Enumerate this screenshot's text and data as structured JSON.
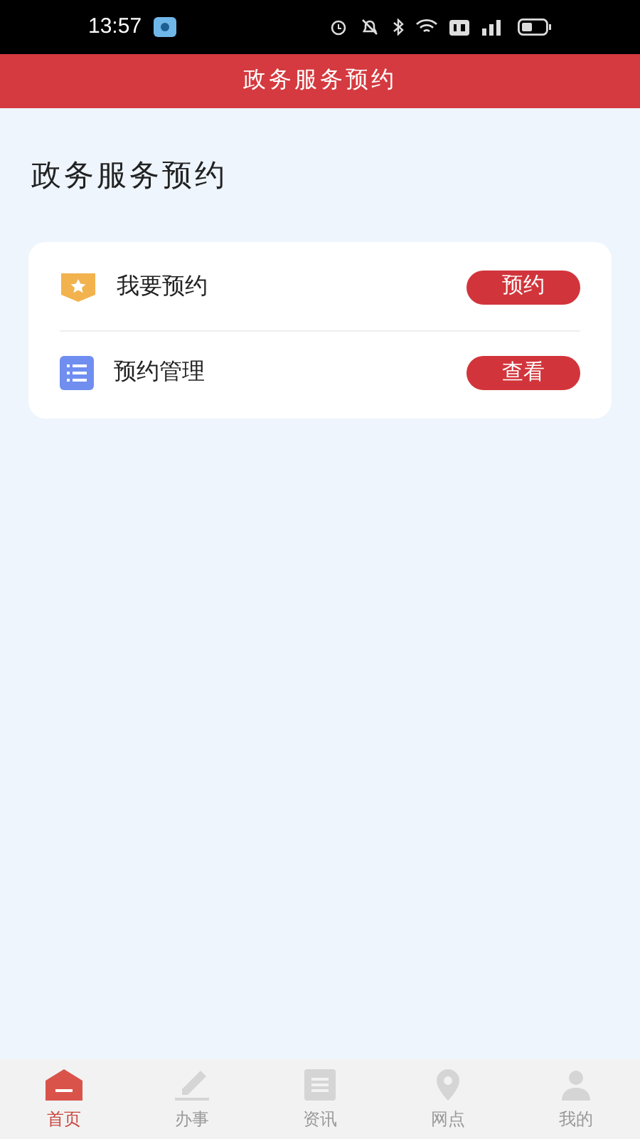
{
  "status_bar": {
    "time": "13:57"
  },
  "header": {
    "title": "政务服务预约"
  },
  "page_title": "政务服务预约",
  "items": [
    {
      "kind": "star",
      "label": "我要预约",
      "action": "预约"
    },
    {
      "kind": "list",
      "label": "预约管理",
      "action": "查看"
    }
  ],
  "tabs": [
    {
      "kind": "home",
      "label": "首页",
      "selected": true
    },
    {
      "kind": "pen",
      "label": "办事",
      "selected": false
    },
    {
      "kind": "doc",
      "label": "资讯",
      "selected": false
    },
    {
      "kind": "pin",
      "label": "网点",
      "selected": false
    },
    {
      "kind": "user",
      "label": "我的",
      "selected": false
    }
  ]
}
